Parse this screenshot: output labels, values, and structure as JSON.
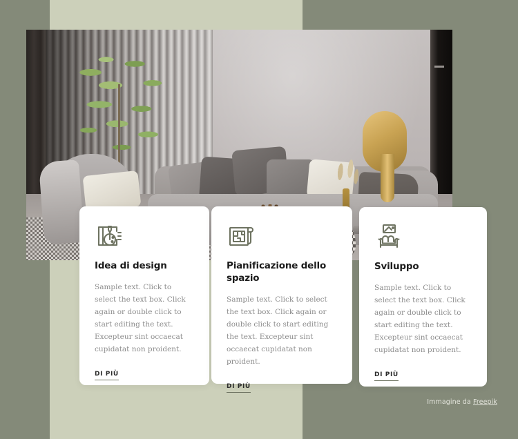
{
  "theme": {
    "outer_background": "#848a79",
    "panel_background": "#ccd0ba",
    "card_background": "#ffffff",
    "title_color": "#1c1c1c",
    "body_color": "#8d8d8d",
    "icon_color": "#6e7361",
    "link_underline_color": "#6e7361"
  },
  "hero": {
    "name": "interior-living-room-photo",
    "alt": "Modern living room with grey sofa, slatted wall, plant and gold lamp"
  },
  "cards": [
    {
      "icon": "design-idea-icon",
      "title": "Idea di design",
      "body": "Sample text. Click to select the text box. Click again or double click to start editing the text. Excepteur sint occaecat cupidatat non proident.",
      "link_label": "DI PIÙ"
    },
    {
      "icon": "floor-plan-icon",
      "title": "Pianificazione dello spazio",
      "body": "Sample text. Click to select the text box. Click again or double click to start editing the text. Excepteur sint occaecat cupidatat non proident.",
      "link_label": "DI PIÙ"
    },
    {
      "icon": "sofa-icon",
      "title": "Sviluppo",
      "body": "Sample text. Click to select the text box. Click again or double click to start editing the text. Excepteur sint occaecat cupidatat non proident.",
      "link_label": "DI PIÙ"
    }
  ],
  "attribution": {
    "prefix": "Immagine da ",
    "link_label": "Freepik"
  }
}
